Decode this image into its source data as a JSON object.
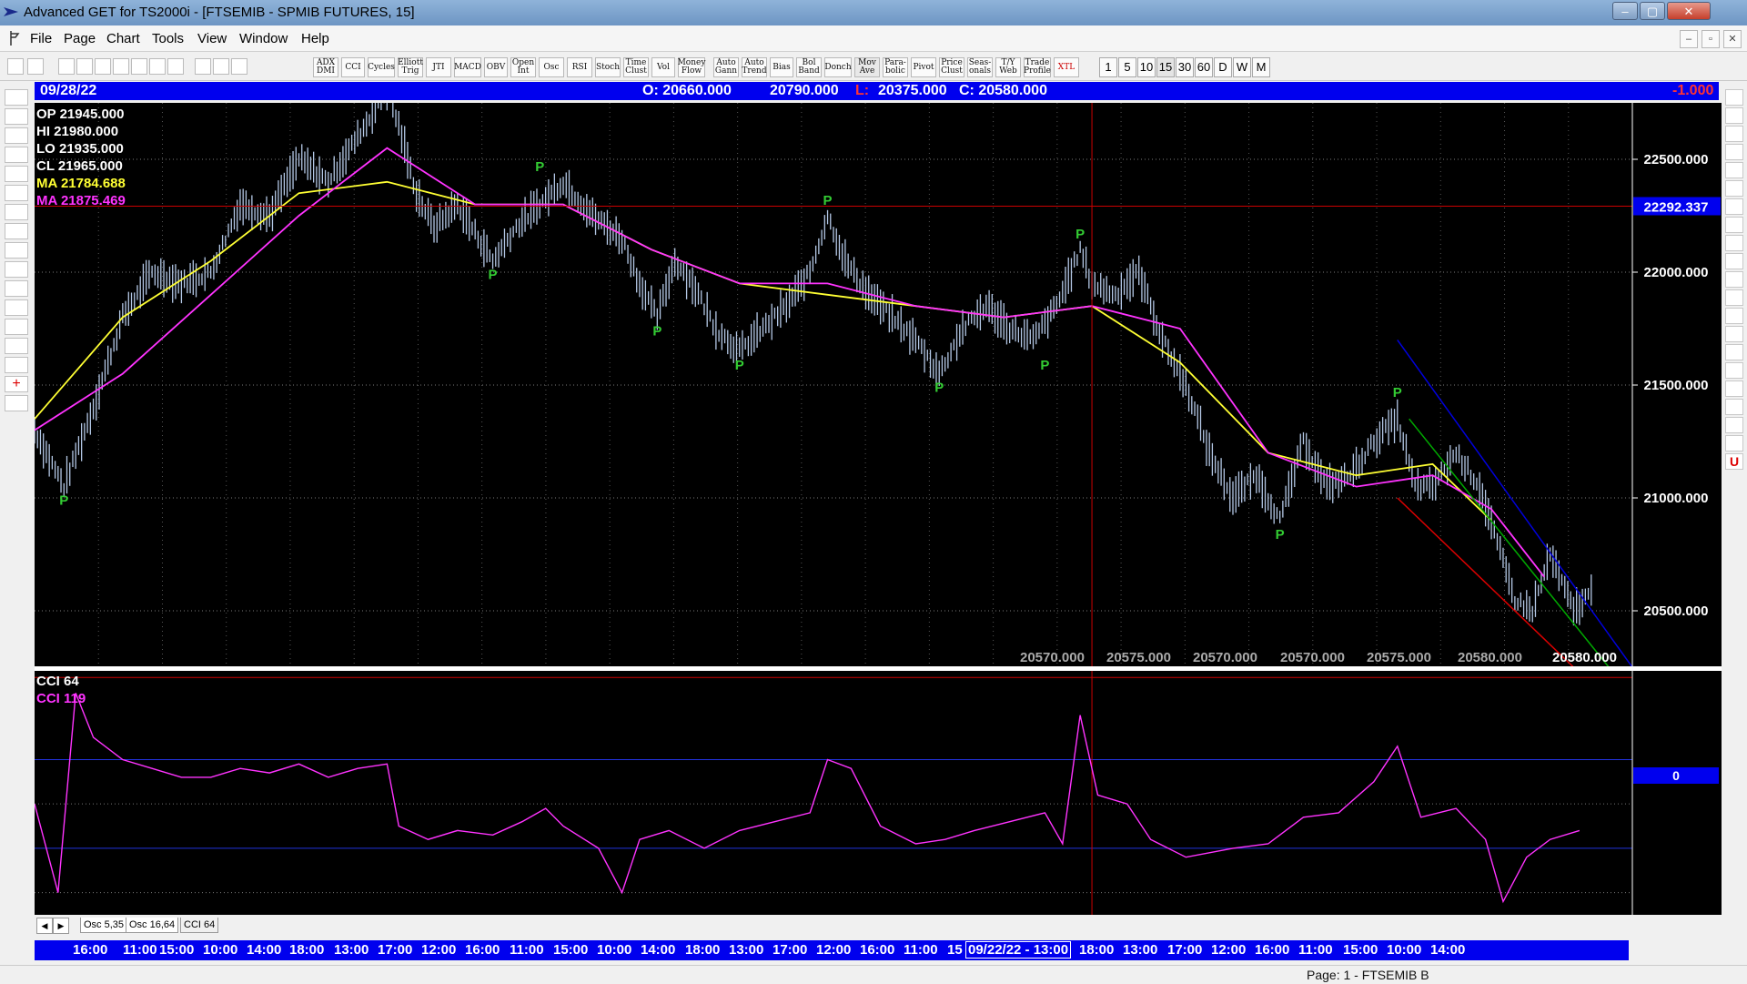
{
  "window": {
    "title": "Advanced GET for TS2000i - [FTSEMIB - SPMIB FUTURES, 15]",
    "controls": [
      "–",
      "▢",
      "✕"
    ]
  },
  "menu": {
    "items": [
      "File",
      "Page",
      "Chart",
      "Tools",
      "View",
      "Window",
      "Help"
    ],
    "mdi_controls": [
      "–",
      "▫",
      "✕"
    ]
  },
  "toolbar": {
    "studies": [
      {
        "label": "ADX\nDMI"
      },
      {
        "label": "CCI"
      },
      {
        "label": "Cycles"
      },
      {
        "label": "Elliott\nTrig"
      },
      {
        "label": "JTI"
      },
      {
        "label": "MACD"
      },
      {
        "label": "OBV"
      },
      {
        "label": "Open\nInt"
      },
      {
        "label": "Osc"
      },
      {
        "label": "RSI"
      },
      {
        "label": "Stoch"
      },
      {
        "label": "Time\nClust"
      },
      {
        "label": "Vol"
      },
      {
        "label": "Money\nFlow"
      },
      {
        "label": "Auto\nGann"
      },
      {
        "label": "Auto\nTrend"
      },
      {
        "label": "Bias"
      },
      {
        "label": "Bol\nBand"
      },
      {
        "label": "Donch"
      },
      {
        "label": "Mov\nAve"
      },
      {
        "label": "Para-\nbolic"
      },
      {
        "label": "Pivot"
      },
      {
        "label": "Price\nClust"
      },
      {
        "label": "Seas-\nonals"
      },
      {
        "label": "T/Y\nWeb"
      },
      {
        "label": "Trade\nProfile"
      },
      {
        "label": "XTL"
      }
    ],
    "intervals": [
      "1",
      "5",
      "10",
      "15",
      "30",
      "60",
      "D",
      "W",
      "M"
    ],
    "active_interval": "15"
  },
  "header": {
    "date": "09/28/22",
    "open": "O: 20660.000",
    "high": "20790.000",
    "low_label": "L:",
    "low": "20375.000",
    "close": "C: 20580.000",
    "change": "-1.000"
  },
  "readout": {
    "op": "OP  21945.000",
    "hi": "HI   21980.000",
    "lo": "LO  21935.000",
    "cl": "CL  21965.000",
    "ma1": "MA  21784.688",
    "ma2": "MA  21875.469"
  },
  "price_axis": {
    "ticks": [
      "22500.000",
      "22000.000",
      "21500.000",
      "21000.000",
      "20500.000"
    ],
    "cursor_price": "22292.337"
  },
  "projection_labels": [
    "20570.000",
    "20575.000",
    "20570.000",
    "20570.000",
    "20575.000",
    "20580.000",
    "20580.000"
  ],
  "pivot_marker": "P",
  "cci": {
    "label1": "CCI 64",
    "label2": "CCI  119",
    "axis_value": "0"
  },
  "tabs": {
    "names": [
      "Osc 5,35",
      "Osc 16,64",
      "CCI 64"
    ],
    "active": "CCI 64"
  },
  "time_axis": {
    "labels": [
      "16:00",
      "11:00",
      "15:00",
      "10:00",
      "14:00",
      "18:00",
      "13:00",
      "17:00",
      "12:00",
      "16:00",
      "11:00",
      "15:00",
      "10:00",
      "14:00",
      "18:00",
      "13:00",
      "17:00",
      "12:00",
      "16:00",
      "11:00",
      "15",
      "09/22/22 - 13:00",
      "18:00",
      "13:00",
      "17:00",
      "12:00",
      "16:00",
      "11:00",
      "15:00",
      "10:00",
      "14:00"
    ]
  },
  "status": {
    "page": "Page: 1 - FTSEMIB B"
  },
  "colors": {
    "background": "#000000",
    "bars": "#b4c8e6",
    "ma_fast": "#ffff33",
    "ma_slow": "#ff33ff",
    "pivot": "#33cc33",
    "header": "#0000ee",
    "cursor": "#cc0000"
  },
  "chart_data": {
    "type": "line",
    "price_ylim": [
      20250,
      22750
    ],
    "price_path": [
      [
        0,
        21300
      ],
      [
        5,
        21050
      ],
      [
        10,
        21400
      ],
      [
        15,
        21800
      ],
      [
        20,
        22000
      ],
      [
        25,
        21950
      ],
      [
        30,
        22000
      ],
      [
        35,
        22300
      ],
      [
        40,
        22250
      ],
      [
        45,
        22500
      ],
      [
        50,
        22400
      ],
      [
        55,
        22600
      ],
      [
        60,
        22800
      ],
      [
        62,
        22650
      ],
      [
        65,
        22350
      ],
      [
        68,
        22200
      ],
      [
        72,
        22300
      ],
      [
        78,
        22050
      ],
      [
        82,
        22200
      ],
      [
        86,
        22300
      ],
      [
        90,
        22400
      ],
      [
        95,
        22250
      ],
      [
        100,
        22150
      ],
      [
        103,
        21950
      ],
      [
        106,
        21800
      ],
      [
        109,
        22050
      ],
      [
        112,
        21950
      ],
      [
        116,
        21750
      ],
      [
        120,
        21650
      ],
      [
        124,
        21750
      ],
      [
        128,
        21850
      ],
      [
        132,
        22000
      ],
      [
        135,
        22250
      ],
      [
        138,
        22050
      ],
      [
        142,
        21900
      ],
      [
        146,
        21800
      ],
      [
        150,
        21700
      ],
      [
        154,
        21550
      ],
      [
        158,
        21750
      ],
      [
        162,
        21850
      ],
      [
        166,
        21750
      ],
      [
        170,
        21700
      ],
      [
        174,
        21850
      ],
      [
        178,
        22100
      ],
      [
        180,
        21950
      ],
      [
        184,
        21900
      ],
      [
        188,
        22000
      ],
      [
        192,
        21700
      ],
      [
        196,
        21500
      ],
      [
        200,
        21200
      ],
      [
        204,
        21000
      ],
      [
        208,
        21100
      ],
      [
        212,
        20900
      ],
      [
        216,
        21250
      ],
      [
        220,
        21050
      ],
      [
        224,
        21100
      ],
      [
        228,
        21250
      ],
      [
        232,
        21350
      ],
      [
        235,
        21050
      ],
      [
        238,
        21050
      ],
      [
        242,
        21200
      ],
      [
        246,
        21050
      ],
      [
        249,
        20800
      ],
      [
        252,
        20550
      ],
      [
        255,
        20500
      ],
      [
        258,
        20750
      ],
      [
        262,
        20500
      ],
      [
        265,
        20580
      ]
    ],
    "ma_fast": [
      [
        0,
        21350
      ],
      [
        15,
        21800
      ],
      [
        30,
        22050
      ],
      [
        45,
        22350
      ],
      [
        60,
        22400
      ],
      [
        75,
        22300
      ],
      [
        90,
        22300
      ],
      [
        105,
        22100
      ],
      [
        120,
        21950
      ],
      [
        135,
        21900
      ],
      [
        150,
        21850
      ],
      [
        165,
        21800
      ],
      [
        180,
        21850
      ],
      [
        195,
        21600
      ],
      [
        210,
        21200
      ],
      [
        225,
        21100
      ],
      [
        238,
        21150
      ],
      [
        248,
        20900
      ]
    ],
    "ma_slow": [
      [
        0,
        21300
      ],
      [
        15,
        21550
      ],
      [
        30,
        21900
      ],
      [
        45,
        22250
      ],
      [
        60,
        22550
      ],
      [
        75,
        22300
      ],
      [
        90,
        22300
      ],
      [
        105,
        22100
      ],
      [
        120,
        21950
      ],
      [
        135,
        21950
      ],
      [
        150,
        21850
      ],
      [
        165,
        21800
      ],
      [
        180,
        21850
      ],
      [
        195,
        21750
      ],
      [
        210,
        21200
      ],
      [
        225,
        21050
      ],
      [
        238,
        21100
      ],
      [
        248,
        20950
      ],
      [
        257,
        20650
      ]
    ],
    "pivots": [
      {
        "bar": 5,
        "type": "low",
        "price": 21050
      },
      {
        "bar": 86,
        "type": "high",
        "price": 22400
      },
      {
        "bar": 78,
        "type": "low",
        "price": 22050
      },
      {
        "bar": 106,
        "type": "low",
        "price": 21800
      },
      {
        "bar": 120,
        "type": "low",
        "price": 21650
      },
      {
        "bar": 135,
        "type": "high",
        "price": 22250
      },
      {
        "bar": 154,
        "type": "low",
        "price": 21550
      },
      {
        "bar": 172,
        "type": "low",
        "price": 21650
      },
      {
        "bar": 178,
        "type": "high",
        "price": 22100
      },
      {
        "bar": 212,
        "type": "low",
        "price": 20900
      },
      {
        "bar": 232,
        "type": "high",
        "price": 21400
      }
    ],
    "cursor": {
      "bar": 180,
      "price": 22292.337
    },
    "channels": [
      {
        "color": "#0000dd",
        "from": [
          232,
          21700
        ],
        "to": [
          272,
          20250
        ]
      },
      {
        "color": "#00aa00",
        "from": [
          234,
          21350
        ],
        "to": [
          268,
          20250
        ]
      },
      {
        "color": "#dd0000",
        "from": [
          232,
          21000
        ],
        "to": [
          262,
          20250
        ]
      }
    ],
    "cci_ylim": [
      -250,
      300
    ],
    "cci_levels": [
      100,
      -100
    ],
    "cci_values": [
      [
        0,
        0
      ],
      [
        4,
        -200
      ],
      [
        7,
        250
      ],
      [
        10,
        150
      ],
      [
        15,
        100
      ],
      [
        20,
        80
      ],
      [
        25,
        60
      ],
      [
        30,
        60
      ],
      [
        35,
        80
      ],
      [
        40,
        70
      ],
      [
        45,
        90
      ],
      [
        50,
        60
      ],
      [
        55,
        80
      ],
      [
        60,
        90
      ],
      [
        62,
        -50
      ],
      [
        67,
        -80
      ],
      [
        72,
        -60
      ],
      [
        78,
        -70
      ],
      [
        83,
        -40
      ],
      [
        87,
        -10
      ],
      [
        90,
        -50
      ],
      [
        96,
        -100
      ],
      [
        100,
        -200
      ],
      [
        103,
        -80
      ],
      [
        108,
        -60
      ],
      [
        114,
        -100
      ],
      [
        120,
        -60
      ],
      [
        126,
        -40
      ],
      [
        132,
        -20
      ],
      [
        135,
        100
      ],
      [
        139,
        80
      ],
      [
        144,
        -50
      ],
      [
        150,
        -90
      ],
      [
        155,
        -80
      ],
      [
        160,
        -60
      ],
      [
        166,
        -40
      ],
      [
        172,
        -20
      ],
      [
        175,
        -90
      ],
      [
        178,
        200
      ],
      [
        181,
        20
      ],
      [
        186,
        0
      ],
      [
        190,
        -80
      ],
      [
        196,
        -120
      ],
      [
        204,
        -100
      ],
      [
        210,
        -90
      ],
      [
        216,
        -30
      ],
      [
        222,
        -20
      ],
      [
        228,
        50
      ],
      [
        232,
        130
      ],
      [
        236,
        -30
      ],
      [
        242,
        -10
      ],
      [
        247,
        -80
      ],
      [
        250,
        -220
      ],
      [
        254,
        -120
      ],
      [
        258,
        -80
      ],
      [
        263,
        -60
      ]
    ]
  }
}
